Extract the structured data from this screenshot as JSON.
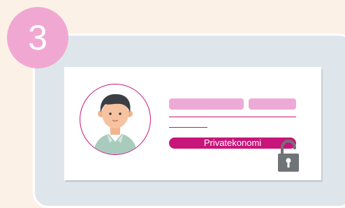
{
  "step": {
    "number": "3"
  },
  "card": {
    "label": "Privatekonomi"
  },
  "colors": {
    "background": "#fcf1e7",
    "panel": "#dfe6eb",
    "badge": "#f0a8d2",
    "accent": "#c7157a",
    "bar": "#eeaad6",
    "lock": "#6f7477"
  },
  "icons": {
    "avatar": "person-avatar-icon",
    "lock": "padlock-open-icon"
  }
}
